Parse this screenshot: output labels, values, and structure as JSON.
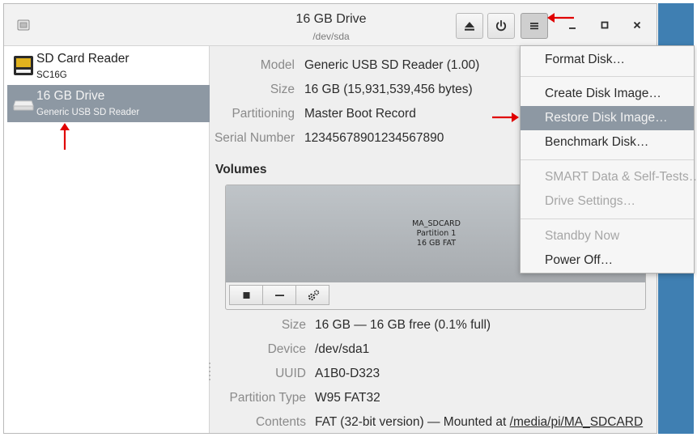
{
  "window": {
    "title": "16 GB Drive",
    "subtitle": "/dev/sda"
  },
  "header_buttons": {
    "eject_icon": "eject-icon",
    "power_icon": "power-icon",
    "menu_icon": "hamburger-menu-icon",
    "minimize_icon": "minimize-icon",
    "maximize_icon": "maximize-icon",
    "close_icon": "close-icon"
  },
  "sidebar": {
    "items": [
      {
        "name": "SD Card Reader",
        "desc": "SC16G",
        "icon": "sd-card-icon",
        "selected": false
      },
      {
        "name": "16 GB Drive",
        "desc": "Generic USB  SD Reader",
        "icon": "drive-icon",
        "selected": true
      }
    ]
  },
  "drive": {
    "model_label": "Model",
    "model": "Generic USB  SD Reader (1.00)",
    "size_label": "Size",
    "size": "16 GB (15,931,539,456 bytes)",
    "partitioning_label": "Partitioning",
    "partitioning": "Master Boot Record",
    "serial_label": "Serial Number",
    "serial": "12345678901234567890"
  },
  "volumes": {
    "heading": "Volumes",
    "partition": {
      "name": "MA_SDCARD",
      "number": "Partition 1",
      "detail": "16 GB FAT"
    },
    "buttons": [
      "stop-icon",
      "minus-icon",
      "gears-icon"
    ]
  },
  "volume_details": {
    "size_label": "Size",
    "size": "16 GB — 16 GB free (0.1% full)",
    "device_label": "Device",
    "device": "/dev/sda1",
    "uuid_label": "UUID",
    "uuid": "A1B0-D323",
    "ptype_label": "Partition Type",
    "ptype": "W95 FAT32",
    "contents_label": "Contents",
    "contents_prefix": "FAT (32-bit version) — Mounted at ",
    "contents_link": "/media/pi/MA_SDCARD"
  },
  "menu": {
    "items": [
      {
        "label": "Format Disk…",
        "enabled": true
      },
      {
        "label": "Create Disk Image…",
        "enabled": true
      },
      {
        "label": "Restore Disk Image…",
        "enabled": true,
        "highlighted": true
      },
      {
        "label": "Benchmark Disk…",
        "enabled": true
      },
      {
        "label": "SMART Data & Self-Tests…",
        "enabled": false
      },
      {
        "label": "Drive Settings…",
        "enabled": false
      },
      {
        "label": "Standby Now",
        "enabled": false
      },
      {
        "label": "Power Off…",
        "enabled": true
      }
    ]
  },
  "colors": {
    "selection": "#8d98a3",
    "annotation_arrow": "#e00000",
    "desktop_strip": "#3f7fb2"
  }
}
